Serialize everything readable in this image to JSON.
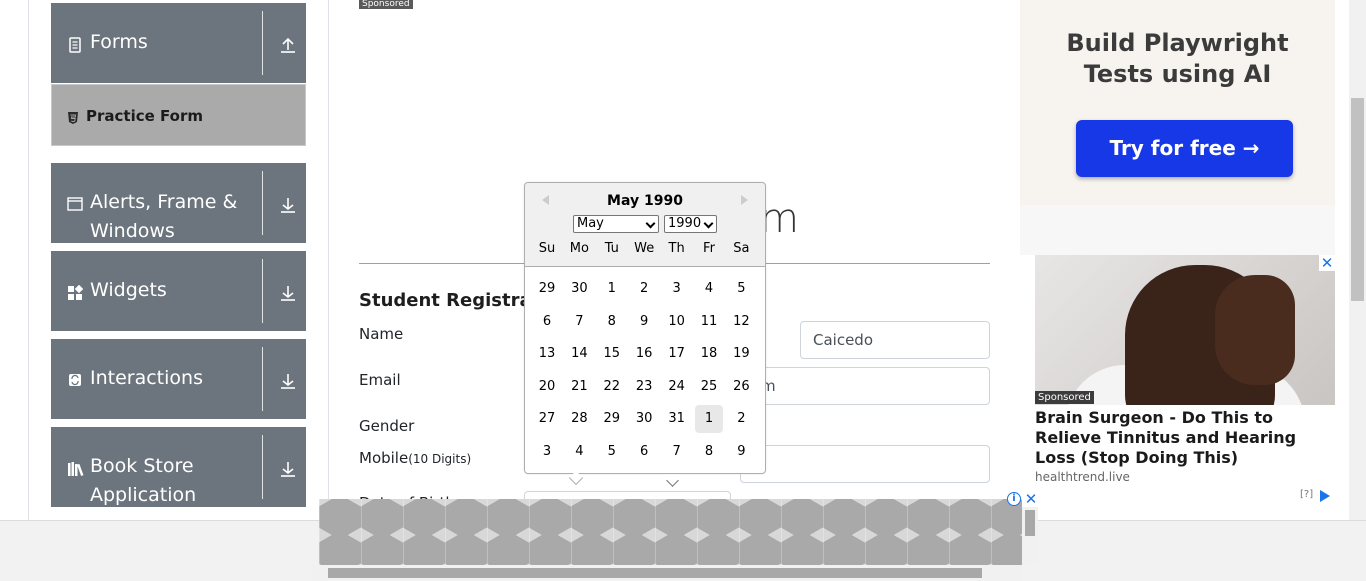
{
  "sidebar": {
    "groups": [
      {
        "label": "Forms",
        "icon": "document-icon"
      },
      {
        "label": "Alerts, Frame &",
        "label2": "Windows",
        "icon": "window-icon"
      },
      {
        "label": "Widgets",
        "icon": "widgets-icon"
      },
      {
        "label": "Interactions",
        "icon": "interactions-icon"
      },
      {
        "label": "Book Store",
        "label2": "Application",
        "icon": "books-icon"
      }
    ],
    "active_item": {
      "label": "Practice Form",
      "icon": "html5-icon"
    }
  },
  "main": {
    "sponsored_label": "Sponsored",
    "title_fragment": "m",
    "form_title": "Student Registratio",
    "fields": {
      "name_label": "Name",
      "last_name_value": "Caicedo",
      "email_label": "Email",
      "email_value_fragment": "m",
      "gender_label": "Gender",
      "mobile_label": "Mobile",
      "mobile_hint": "(10 Digits)",
      "dob_label": "Date of Birth"
    }
  },
  "datepicker": {
    "current_month": "May 1990",
    "month_select": "May",
    "year_select": "1990",
    "weekdays": [
      "Su",
      "Mo",
      "Tu",
      "We",
      "Th",
      "Fr",
      "Sa"
    ],
    "weeks": [
      [
        "29",
        "30",
        "1",
        "2",
        "3",
        "4",
        "5"
      ],
      [
        "6",
        "7",
        "8",
        "9",
        "10",
        "11",
        "12"
      ],
      [
        "13",
        "14",
        "15",
        "16",
        "17",
        "18",
        "19"
      ],
      [
        "20",
        "21",
        "22",
        "23",
        "24",
        "25",
        "26"
      ],
      [
        "27",
        "28",
        "29",
        "30",
        "31",
        "1",
        "2"
      ],
      [
        "3",
        "4",
        "5",
        "6",
        "7",
        "8",
        "9"
      ]
    ],
    "selected_day": "1"
  },
  "ads": {
    "top": {
      "headline_line1": "Build Playwright",
      "headline_line2": "Tests using AI",
      "button": "Try for free →"
    },
    "side": {
      "sponsored": "Sponsored",
      "close": "✕",
      "text": "Brain Surgeon - Do This to Relieve Tinnitus and Hearing Loss (Stop Doing This)",
      "domain": "healthtrend.live",
      "qmark": "[?]"
    },
    "bottom": {
      "info": "i",
      "close": "✕"
    }
  }
}
